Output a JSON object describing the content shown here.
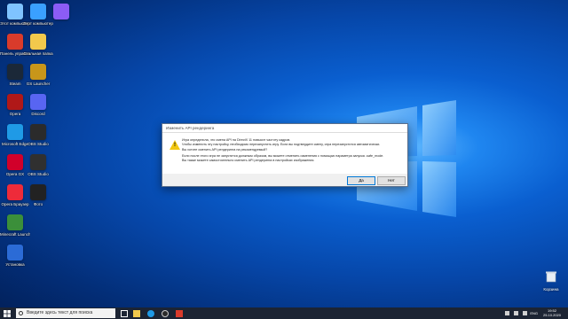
{
  "desktop": {
    "icons": [
      {
        "label": "Этот компьютер",
        "color": "#7fc3ff"
      },
      {
        "label": "Этот компьютер",
        "color": "#3aa0ff"
      },
      {
        "label": "",
        "color": "#8b5cf6"
      },
      {
        "label": "Панель управления",
        "color": "#d93b2b"
      },
      {
        "label": "Стальная папка",
        "color": "#f2c94c"
      },
      {
        "label": "Steam",
        "color": "#1b2838"
      },
      {
        "label": "GS Launcher",
        "color": "#c8961a"
      },
      {
        "label": "Opera",
        "color": "#b01818"
      },
      {
        "label": "Discord",
        "color": "#5865f2"
      },
      {
        "label": "Microsoft Edge",
        "color": "#1f9ae6"
      },
      {
        "label": "OBS Studio",
        "color": "#2b2b2b"
      },
      {
        "label": "Opera GX",
        "color": "#d1002a"
      },
      {
        "label": "OBS Studio",
        "color": "#303030"
      },
      {
        "label": "Opera Браузер",
        "color": "#ee2b3a"
      },
      {
        "label": "Фото",
        "color": "#222222"
      },
      {
        "label": "Minecraft Launcher",
        "color": "#3b8f3a"
      },
      {
        "label": "Установка",
        "color": "#2b6bd6"
      }
    ],
    "recycle_bin": {
      "label": "Корзина"
    }
  },
  "dialog": {
    "title": "Изменить API рендеринга",
    "p1": "Игра определила, что смена API на DirectX 11 повысит частоту кадров.",
    "p2": "Чтобы изменить эту настройку, необходимо перезапустить игру. Если вы подтвердите смену, игра перезапустится автоматически.",
    "p3": "Вы хотите сменить API рендеринга на рекомендуемый?",
    "p4": "Если после этого игра не запустится должным образом, вы можете отменить изменения с помощью параметра запуска -safe_mode.",
    "p5": "Вы также можете самостоятельно сменить API рендеринга в настройках изображения.",
    "yes_label": "Да",
    "no_label": "Нет",
    "warning_icon": "warning-icon"
  },
  "taskbar": {
    "search_placeholder": "Введите здесь текст для поиска",
    "language": "ENG",
    "time": "19:52",
    "date": "25.10.2020",
    "accent": "#0078d7"
  }
}
